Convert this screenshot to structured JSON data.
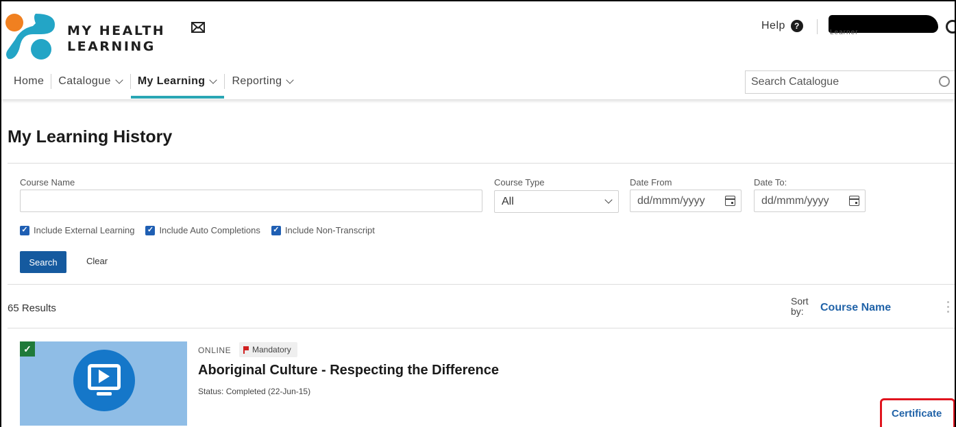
{
  "header": {
    "brand_line1": "MY HEALTH",
    "brand_line2": "LEARNING",
    "help_label": "Help",
    "user_role": "Learner",
    "icons": [
      "logo-icon",
      "mail-icon",
      "help-icon",
      "user-icon",
      "search-icon"
    ],
    "logo_colors": [
      "#f08020",
      "#23a5c6"
    ]
  },
  "nav": {
    "home": "Home",
    "catalogue": "Catalogue",
    "my_learning": "My Learning",
    "reporting": "Reporting",
    "search_placeholder": "Search Catalogue",
    "accent": "#2aa6b4"
  },
  "page": {
    "title": "My Learning History"
  },
  "filters": {
    "course_name_label": "Course Name",
    "course_name_value": "",
    "course_type_label": "Course Type",
    "course_type_value": "All",
    "date_from_label": "Date From",
    "date_from_placeholder": "dd/mmm/yyyy",
    "date_to_label": "Date To:",
    "date_to_placeholder": "dd/mmm/yyyy",
    "include_external": "Include External Learning",
    "include_auto": "Include Auto Completions",
    "include_non_transcript": "Include Non-Transcript",
    "search_button": "Search",
    "clear_button": "Clear"
  },
  "results": {
    "count_text": "65 Results",
    "sort_label_1": "Sort",
    "sort_label_2": "by:",
    "sort_value": "Course Name"
  },
  "course": {
    "type": "ONLINE",
    "badge": "Mandatory",
    "title": "Aboriginal Culture - Respecting the Difference",
    "status": "Status: Completed  (22-Jun-15)",
    "certificate_link": "Certificate",
    "completed_check": "✓"
  }
}
